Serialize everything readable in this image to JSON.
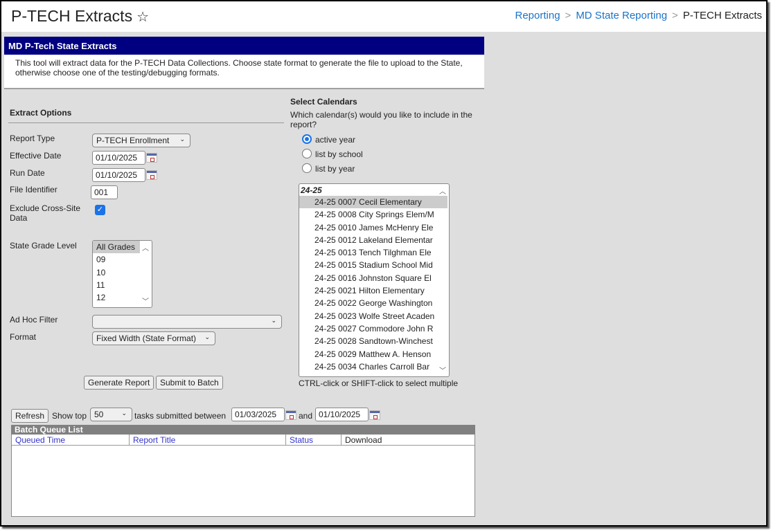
{
  "header": {
    "title": "P-TECH Extracts",
    "favorite_icon": "star-outline-icon",
    "breadcrumb": [
      {
        "label": "Reporting"
      },
      {
        "label": "MD State Reporting"
      },
      {
        "label": "P-TECH Extracts"
      }
    ],
    "breadcrumb_separator": ">"
  },
  "panel": {
    "title": "MD P-Tech State Extracts",
    "description_line1": "This tool will extract data for the P-TECH Data Collections. Choose state format to generate the file to upload to the State,",
    "description_line2": "otherwise choose one of the testing/debugging formats."
  },
  "extract_options": {
    "title": "Extract Options",
    "report_type": {
      "label": "Report Type",
      "value": "P-TECH Enrollment"
    },
    "effective_date": {
      "label": "Effective Date",
      "value": "01/10/2025"
    },
    "run_date": {
      "label": "Run Date",
      "value": "01/10/2025"
    },
    "file_identifier": {
      "label": "File Identifier",
      "value": "001"
    },
    "exclude_cross_site": {
      "label_line1": "Exclude Cross-Site",
      "label_line2": "Data",
      "checked": true,
      "check_glyph": "✓"
    },
    "state_grade_level": {
      "label": "State Grade Level",
      "options": [
        "All Grades",
        "09",
        "10",
        "11",
        "12"
      ],
      "selected": "All Grades"
    },
    "ad_hoc_filter": {
      "label": "Ad Hoc Filter",
      "value": ""
    },
    "format": {
      "label": "Format",
      "value": "Fixed Width (State Format)"
    },
    "generate_button": "Generate Report",
    "submit_batch_button": "Submit to Batch"
  },
  "calendars": {
    "title": "Select Calendars",
    "question_line1": "Which calendar(s) would you like to include in the",
    "question_line2": "report?",
    "radios": [
      {
        "label": "active year",
        "checked": true
      },
      {
        "label": "list by school",
        "checked": false
      },
      {
        "label": "list by year",
        "checked": false
      }
    ],
    "group": "24-25",
    "items": [
      "24-25 0007 Cecil Elementary",
      "24-25 0008 City Springs Elem/M",
      "24-25 0010 James McHenry Ele",
      "24-25 0012 Lakeland Elementar",
      "24-25 0013 Tench Tilghman Ele",
      "24-25 0015 Stadium School Mid",
      "24-25 0016 Johnston Square El",
      "24-25 0021 Hilton Elementary",
      "24-25 0022 George Washington",
      "24-25 0023 Wolfe Street Acaden",
      "24-25 0027 Commodore John R",
      "24-25 0028 Sandtown-Winchest",
      "24-25 0029 Matthew A. Henson",
      "24-25 0034 Charles Carroll Bar"
    ],
    "selected": "24-25 0007 Cecil Elementary",
    "hint": "CTRL-click or SHIFT-click to select multiple"
  },
  "batch": {
    "refresh_button": "Refresh",
    "show_top_label": "Show top",
    "show_top_value": "50",
    "between_label": "tasks submitted between",
    "start_date": "01/03/2025",
    "and_label": "and",
    "end_date": "01/10/2025",
    "list_title": "Batch Queue List",
    "columns": [
      "Queued Time",
      "Report Title",
      "Status",
      "Download"
    ],
    "rows": []
  }
}
